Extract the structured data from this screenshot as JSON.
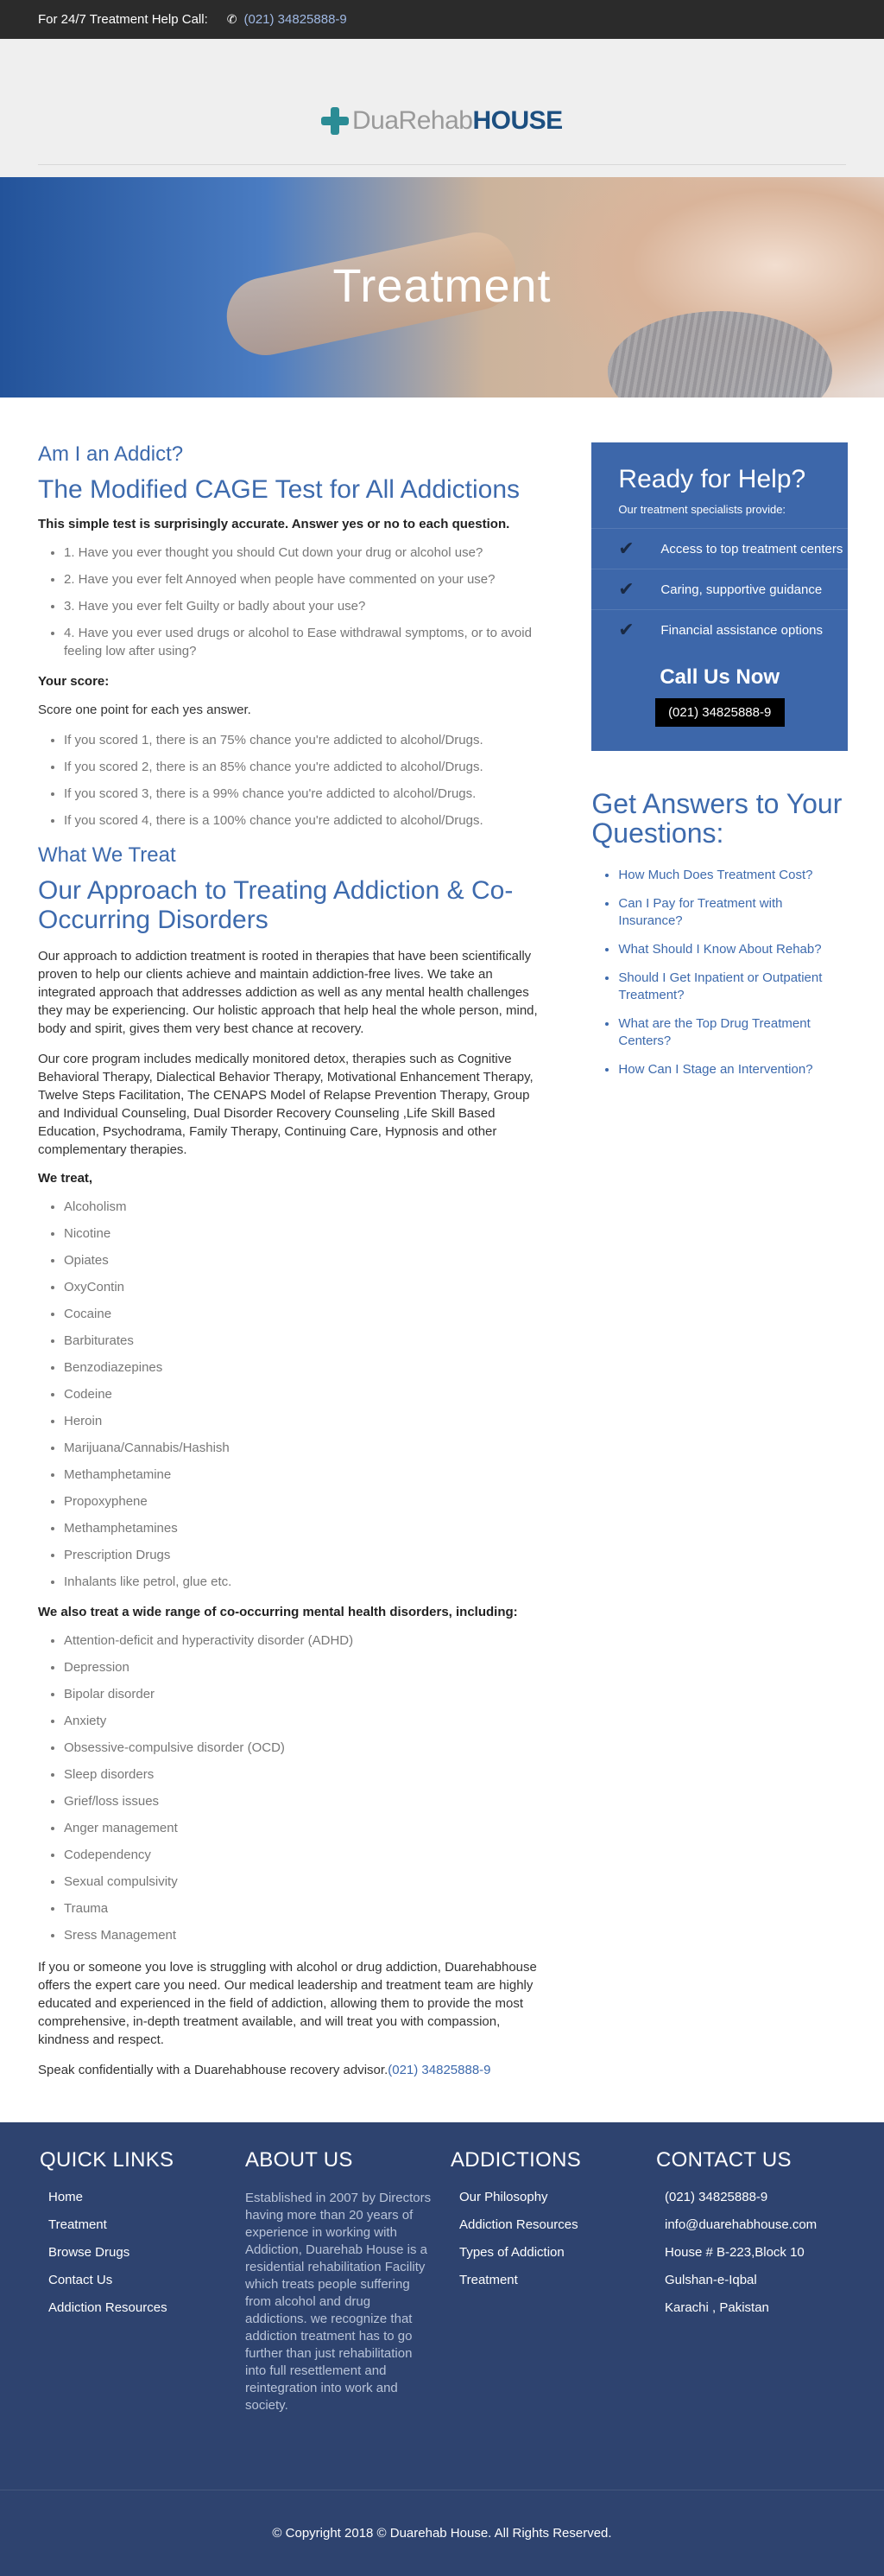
{
  "topbar": {
    "label": "For 24/7 Treatment Help Call:",
    "phone": "(021) 34825888-9",
    "phone_icon": "phone-icon"
  },
  "logo": {
    "dua": "DuaRehab",
    "house": "HOUSE"
  },
  "hero": {
    "title": "Treatment"
  },
  "main": {
    "h1": "Am I an Addict?",
    "h2": "The Modified CAGE Test for All Addictions",
    "intro": "This simple test is surprisingly accurate. Answer yes or no to each question.",
    "questions": [
      "1. Have you ever thought you should Cut down your drug or alcohol use?",
      "2. Have you ever felt Annoyed when people have commented on your use?",
      "3. Have you ever felt Guilty or badly about your use?",
      "4. Have you ever used drugs or alcohol to Ease withdrawal symptoms, or to avoid feeling low after using?"
    ],
    "score_heading": "Your score:",
    "score_intro": "Score one point for each yes answer.",
    "scores": [
      "If you scored 1, there is an 75% chance you're addicted to alcohol/Drugs.",
      "If you scored 2, there is an 85% chance you're addicted to alcohol/Drugs.",
      "If you scored 3, there is a 99% chance you're addicted to alcohol/Drugs.",
      "If you scored 4, there is a 100% chance you're addicted to alcohol/Drugs."
    ],
    "h3": "What We Treat",
    "h4": "Our Approach to Treating Addiction & Co-Occurring Disorders",
    "p1": "Our approach to addiction treatment is rooted in therapies that have been scientifically proven to help our clients achieve and maintain addiction-free lives. We take an integrated approach that addresses addiction as well as any mental health challenges they may be experiencing. Our holistic approach that help heal the whole person, mind, body and spirit, gives them very best chance at recovery.",
    "p2": "Our core program includes medically monitored detox, therapies such as Cognitive Behavioral Therapy, Dialectical Behavior Therapy, Motivational Enhancement Therapy, Twelve Steps Facilitation, The CENAPS Model of Relapse Prevention Therapy, Group and Individual Counseling, Dual Disorder Recovery Counseling ,Life Skill Based Education, Psychodrama, Family Therapy, Continuing Care, Hypnosis and other complementary therapies.",
    "we_treat": "We treat,",
    "substances": [
      "Alcoholism",
      "Nicotine",
      "Opiates",
      "OxyContin",
      "Cocaine",
      "Barbiturates",
      "Benzodiazepines",
      "Codeine",
      "Heroin",
      "Marijuana/Cannabis/Hashish",
      "Methamphetamine",
      "Propoxyphene",
      "Methamphetamines",
      "Prescription Drugs",
      "Inhalants like petrol, glue etc."
    ],
    "also_treat": "We also treat a wide range of co-occurring mental health disorders, including:",
    "disorders": [
      "Attention-deficit and hyperactivity disorder (ADHD)",
      "Depression",
      "Bipolar disorder",
      "Anxiety",
      "Obsessive-compulsive disorder (OCD)",
      "Sleep disorders",
      "Grief/loss issues",
      "Anger management",
      "Codependency",
      "Sexual compulsivity",
      "Trauma",
      "Sress Management"
    ],
    "p3": "If you or someone you love is struggling with alcohol or drug addiction, Duarehabhouse offers the expert care you need. Our medical leadership and treatment team are highly educated and experienced in the field of addiction, allowing them to provide the most comprehensive, in-depth treatment available, and will treat you with compassion, kindness and respect.",
    "speak": "Speak confidentially with a Duarehabhouse recovery advisor.",
    "speak_phone": "(021) 34825888-9"
  },
  "sidebar": {
    "title": "Ready for Help?",
    "sub": "Our treatment specialists provide:",
    "items": [
      "Access to top treatment centers",
      "Caring, supportive guidance",
      "Financial assistance options"
    ],
    "call": "Call Us Now",
    "phone": "(021) 34825888-9",
    "qa_title": "Get Answers to Your Questions:",
    "questions": [
      "How Much Does Treatment Cost?",
      "Can I Pay for Treatment with Insurance?",
      "What Should I Know About Rehab?",
      "Should I Get Inpatient or Outpatient Treatment?",
      "What are the Top Drug Treatment Centers?",
      "How Can I Stage an Intervention?"
    ]
  },
  "footer": {
    "quick_title": "QUICK LINKS",
    "quick_links": [
      "Home",
      "Treatment",
      "Browse Drugs",
      "Contact Us",
      "Addiction Resources"
    ],
    "about_title": "ABOUT US",
    "about_text": "Established in 2007 by Directors having more than 20 years of experience in working with Addiction, Duarehab House is a residential rehabilitation Facility which treats people suffering from alcohol and drug addictions. we recognize that addiction treatment has to go further than just rehabilitation into full resettlement and reintegration into work and society.",
    "addictions_title": "ADDICTIONS",
    "addictions_links": [
      "Our Philosophy",
      "Addiction Resources",
      "Types of Addiction",
      "Treatment"
    ],
    "contact_title": "CONTACT US",
    "contact_items": [
      "(021) 34825888-9",
      "info@duarehabhouse.com",
      "House # B-223,Block 10",
      "Gulshan-e-Iqbal",
      "Karachi , Pakistan"
    ],
    "copyright": "© Copyright 2018 © Duarehab House. All Rights Reserved."
  }
}
